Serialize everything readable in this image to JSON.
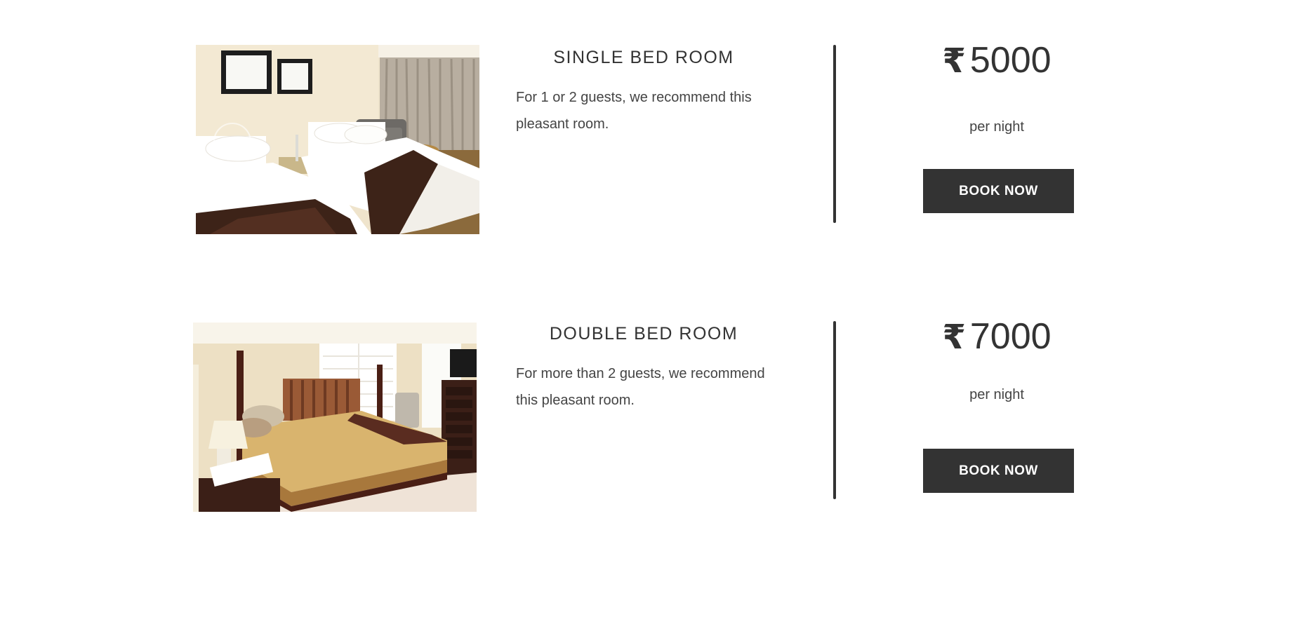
{
  "rooms": [
    {
      "title": "SINGLE BED ROOM",
      "description": "For 1 or 2 guests, we recommend this pleasant room.",
      "currency_symbol": "₹",
      "price": "5000",
      "price_unit": "per night",
      "book_label": "BOOK NOW"
    },
    {
      "title": "DOUBLE BED ROOM",
      "description": "For more than 2 guests, we recommend this pleasant room.",
      "currency_symbol": "₹",
      "price": "7000",
      "price_unit": "per night",
      "book_label": "BOOK NOW"
    }
  ],
  "colors": {
    "text": "#333333",
    "button_bg": "#333333",
    "button_text": "#ffffff",
    "divider": "#333333"
  }
}
